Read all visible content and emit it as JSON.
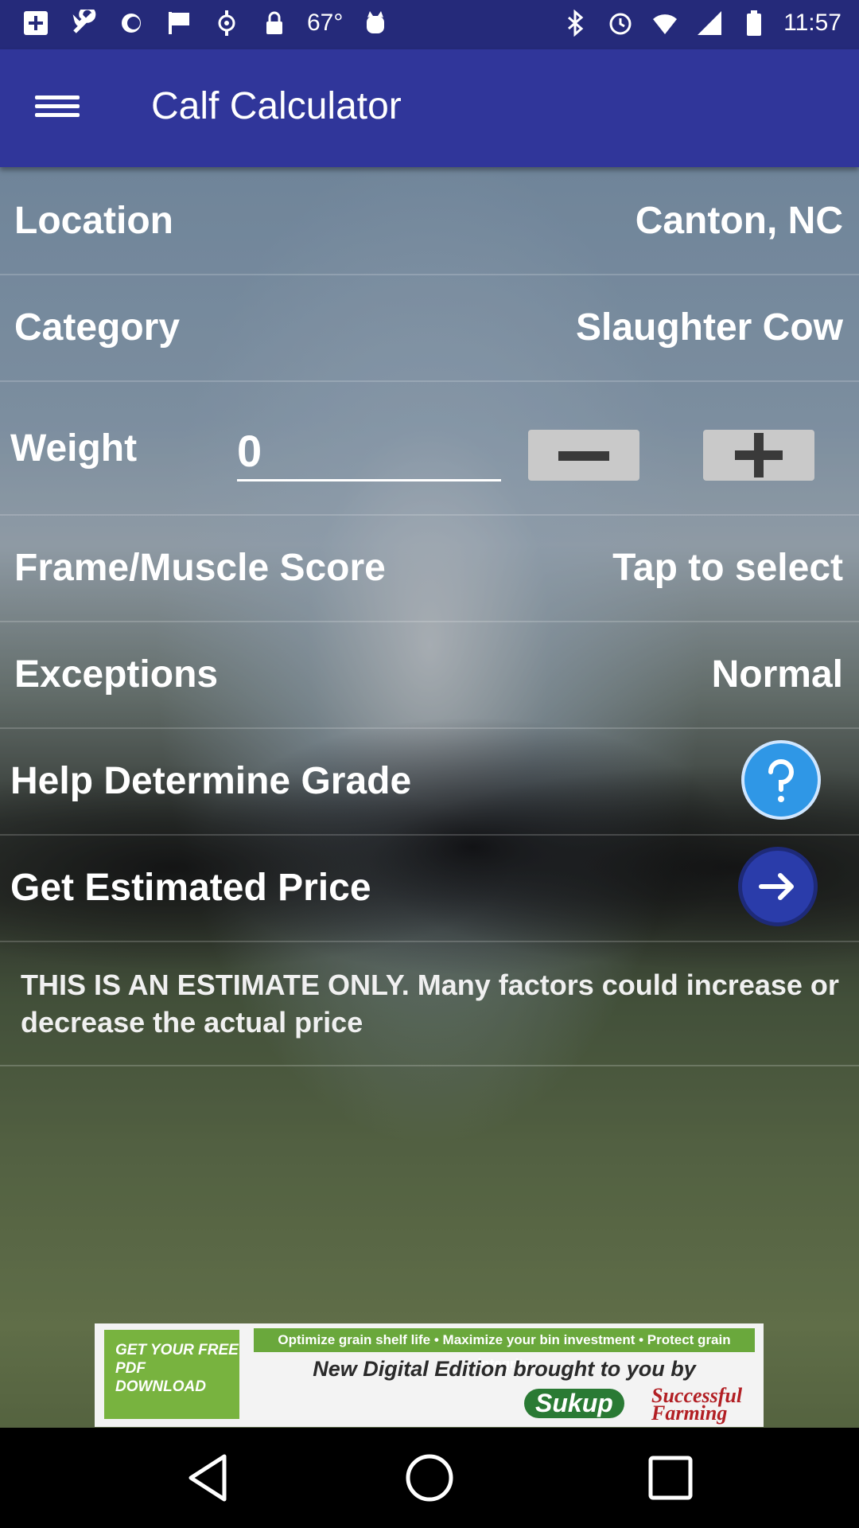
{
  "status_bar": {
    "time": "11:57",
    "temperature": "67°",
    "left_icons": [
      "add-box-icon",
      "wrench-icon",
      "brightness-icon",
      "flag-icon",
      "fake-gps-icon",
      "lock-icon",
      "temperature-icon",
      "cat-icon"
    ],
    "right_icons": [
      "bluetooth-icon",
      "alarm-icon",
      "wifi-icon",
      "signal-icon",
      "battery-icon"
    ]
  },
  "app_bar": {
    "title": "Calf Calculator",
    "menu_icon": "hamburger-menu-icon",
    "background": "#30369a"
  },
  "form": {
    "location": {
      "label": "Location",
      "value": "Canton, NC"
    },
    "category": {
      "label": "Category",
      "value": "Slaughter Cow"
    },
    "weight": {
      "label": "Weight",
      "value": "0"
    },
    "frame_muscle": {
      "label": "Frame/Muscle Score",
      "value": "Tap to select"
    },
    "exceptions": {
      "label": "Exceptions",
      "value": "Normal"
    },
    "help_grade": {
      "label": "Help Determine Grade",
      "icon": "help-icon"
    },
    "estimated_price": {
      "label": "Get Estimated Price",
      "icon": "arrow-right-icon"
    }
  },
  "disclaimer": "THIS IS AN ESTIMATE ONLY. Many factors could increase or decrease the actual price",
  "ad": {
    "left_text": "GET YOUR FREE PDF DOWNLOAD",
    "top_text": "Optimize grain shelf life • Maximize your bin investment • Protect grain integrity",
    "middle_text": "New Digital Edition brought to you by",
    "brand1": "Sukup",
    "brand2": "Successful Farming"
  },
  "nav_bar": {
    "icons": [
      "back-icon",
      "home-icon",
      "recent-apps-icon"
    ]
  }
}
